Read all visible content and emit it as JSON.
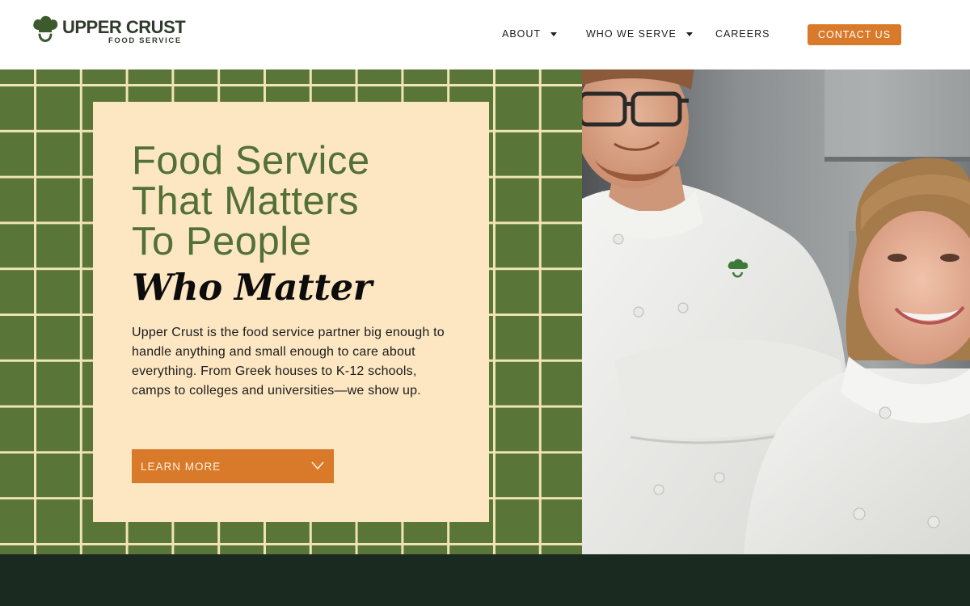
{
  "brand": {
    "name": "UPPER CRUST",
    "tagline": "FOOD SERVICE",
    "icon": "chef-hat-smile-icon",
    "color": "#3d5a2e"
  },
  "nav": {
    "items": [
      {
        "label": "ABOUT",
        "has_dropdown": true
      },
      {
        "label": "WHO WE SERVE",
        "has_dropdown": true
      },
      {
        "label": "CAREERS",
        "has_dropdown": false
      }
    ],
    "cta_label": "CONTACT US"
  },
  "hero": {
    "headline_lines": [
      "Food Service",
      "That Matters",
      "To People"
    ],
    "headline_accent": "Who Matter",
    "body": "Upper Crust is the food service partner big enough to handle anything and small enough to care about everything. From Greek houses to K-12 schools, camps to colleges and universities—we show up.",
    "button_label": "LEARN MORE",
    "button_icon": "chevron-down-icon",
    "photo_icon": "chefs-photo"
  },
  "colors": {
    "accent_orange": "#d97a2b",
    "grid_green": "#597538",
    "grid_line": "#f1e4b4",
    "card_cream": "#fde7c3",
    "headline_green": "#537036",
    "footer_dark": "#1b2a21"
  }
}
